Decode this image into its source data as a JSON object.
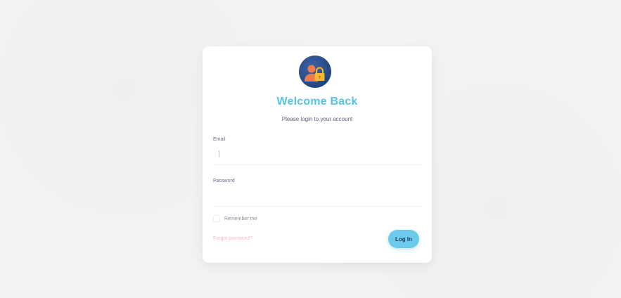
{
  "login": {
    "title": "Welcome Back",
    "subtitle": "Please login to your account",
    "email_label": "Email",
    "email_value": "",
    "email_placeholder": "",
    "password_label": "Password",
    "password_value": "",
    "password_placeholder": "",
    "remember_label": "Remember me",
    "remember_checked": false,
    "forgot_label": "Forgot password?",
    "submit_label": "Log In"
  },
  "colors": {
    "accent": "#56c3e6",
    "button": "#6ccbec",
    "avatar_bg": "#2b4f8f",
    "lock": "#f5b82e",
    "user": "#f07a4a",
    "forgot_link": "#f7b8cf"
  },
  "icons": {
    "avatar": "user-lock-icon"
  }
}
